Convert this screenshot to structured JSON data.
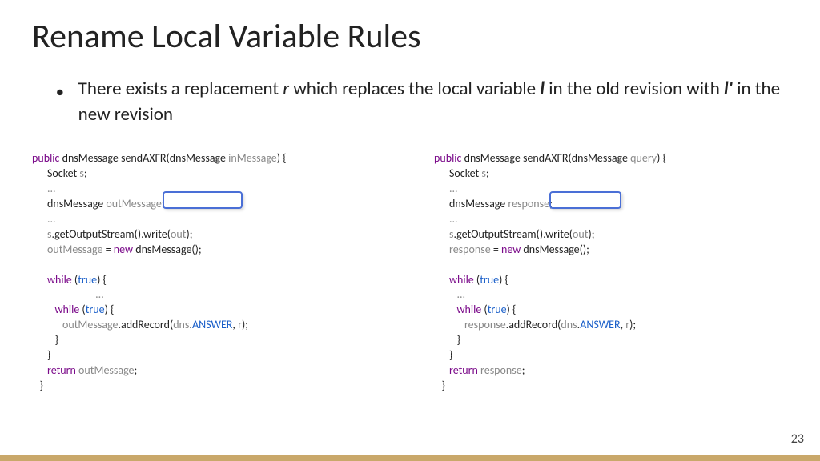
{
  "title": "Rename Local Variable Rules",
  "bullet": {
    "pre1": "There exists a replacement ",
    "r": "r",
    "pre2": " which replaces the local variable ",
    "l": "l",
    "pre3": " in the old revision with ",
    "lprime": "l'",
    "post": " in the new revision"
  },
  "code_left": {
    "l0_a": "public",
    "l0_b": " dnsMessage sendAXFR(dnsMessage ",
    "l0_c": "inMessage",
    "l0_d": ") {",
    "l1_a": "      Socket ",
    "l1_b": "s",
    "l1_c": ";",
    "l2": "      ...",
    "l3_a": "      dnsMessage ",
    "l3_b": "outMessage",
    "l3_c": ";",
    "l4": "      ...",
    "l5_a": "      ",
    "l5_b": "s",
    "l5_c": ".getOutputStream().write(",
    "l5_d": "out",
    "l5_e": ");",
    "l6_a": "      ",
    "l6_b": "outMessage",
    "l6_c": " = ",
    "l6_d": "new",
    "l6_e": " dnsMessage();",
    "l7": "",
    "l8_a": "      ",
    "l8_b": "while",
    "l8_c": " (",
    "l8_d": "true",
    "l8_e": ") {",
    "l9": "                         ...",
    "l10_a": "         ",
    "l10_b": "while",
    "l10_c": " (",
    "l10_d": "true",
    "l10_e": ") {",
    "l11_a": "            ",
    "l11_b": "outMessage",
    "l11_c": ".addRecord(",
    "l11_d": "dns",
    "l11_e": ".",
    "l11_f": "ANSWER",
    "l11_g": ", ",
    "l11_h": "r",
    "l11_i": ");",
    "l12": "         }",
    "l13": "      }",
    "l14_a": "      ",
    "l14_b": "return",
    "l14_c": " ",
    "l14_d": "outMessage",
    "l14_e": ";",
    "l15": "   }"
  },
  "code_right": {
    "l0_a": "public",
    "l0_b": " dnsMessage sendAXFR(dnsMessage ",
    "l0_c": "query",
    "l0_d": ") {",
    "l1_a": "      Socket ",
    "l1_b": "s",
    "l1_c": ";",
    "l2": "      ...",
    "l3_a": "      dnsMessage ",
    "l3_b": "response",
    "l3_c": ";",
    "l4": "      ...",
    "l5_a": "      ",
    "l5_b": "s",
    "l5_c": ".getOutputStream().write(",
    "l5_d": "out",
    "l5_e": ");",
    "l6_a": "      ",
    "l6_b": "response",
    "l6_c": " = ",
    "l6_d": "new",
    "l6_e": " dnsMessage();",
    "l7": "",
    "l8_a": "      ",
    "l8_b": "while",
    "l8_c": " (",
    "l8_d": "true",
    "l8_e": ") {",
    "l9": "         ...",
    "l10_a": "         ",
    "l10_b": "while",
    "l10_c": " (",
    "l10_d": "true",
    "l10_e": ") {",
    "l11_a": "            ",
    "l11_b": "response",
    "l11_c": ".addRecord(",
    "l11_d": "dns",
    "l11_e": ".",
    "l11_f": "ANSWER",
    "l11_g": ", ",
    "l11_h": "r",
    "l11_i": ");",
    "l12": "         }",
    "l13": "      }",
    "l14_a": "      ",
    "l14_b": "return",
    "l14_c": " ",
    "l14_d": "response",
    "l14_e": ";",
    "l15": "   }"
  },
  "page_number": "23"
}
